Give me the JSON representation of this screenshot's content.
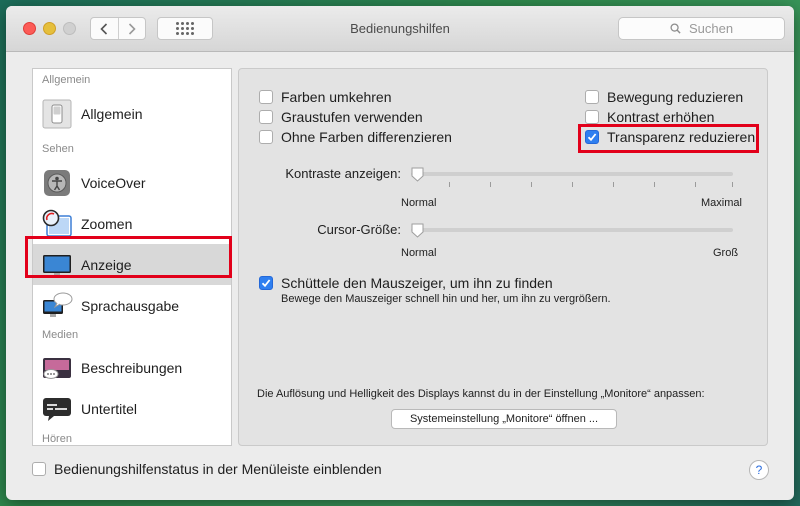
{
  "window": {
    "title": "Bedienungshilfen"
  },
  "toolbar": {
    "back_icon": "chevron-left-icon",
    "forward_icon": "chevron-right-icon",
    "grid_icon": "grid-icon"
  },
  "search": {
    "placeholder": "Suchen"
  },
  "sidebar": {
    "sections": [
      {
        "header": "Allgemein",
        "items": [
          {
            "label": "Allgemein",
            "icon": "general-switch-icon"
          }
        ]
      },
      {
        "header": "Sehen",
        "items": [
          {
            "label": "VoiceOver",
            "icon": "voiceover-icon"
          },
          {
            "label": "Zoomen",
            "icon": "zoom-icon"
          },
          {
            "label": "Anzeige",
            "icon": "display-icon",
            "selected": true
          },
          {
            "label": "Sprachausgabe",
            "icon": "speech-icon"
          }
        ]
      },
      {
        "header": "Medien",
        "items": [
          {
            "label": "Beschreibungen",
            "icon": "descriptions-icon"
          },
          {
            "label": "Untertitel",
            "icon": "subtitles-icon"
          }
        ]
      },
      {
        "header": "Hören",
        "items": []
      }
    ]
  },
  "display": {
    "options_left": [
      {
        "label": "Farben umkehren",
        "checked": false
      },
      {
        "label": "Graustufen verwenden",
        "checked": false
      },
      {
        "label": "Ohne Farben differenzieren",
        "checked": false
      }
    ],
    "options_right": [
      {
        "label": "Bewegung reduzieren",
        "checked": false
      },
      {
        "label": "Kontrast erhöhen",
        "checked": false
      },
      {
        "label": "Transparenz reduzieren",
        "checked": true
      }
    ],
    "contrast_slider": {
      "label": "Kontraste anzeigen:",
      "min_label": "Normal",
      "max_label": "Maximal",
      "value": 0
    },
    "cursor_slider": {
      "label": "Cursor-Größe:",
      "min_label": "Normal",
      "max_label": "Groß",
      "value": 0
    },
    "shake_option": {
      "label": "Schüttele den Mauszeiger, um ihn zu finden",
      "checked": true,
      "description": "Bewege den Mauszeiger schnell hin und her, um ihn zu vergrößern."
    },
    "monitor_info": "Die Auflösung und Helligkeit des Displays kannst du in der Einstellung „Monitore“ anpassen:",
    "monitor_button": "Systemeinstellung „Monitore“ öffnen ..."
  },
  "footer": {
    "status_checkbox_label": "Bedienungshilfenstatus in der Menüleiste einblenden",
    "status_checked": false,
    "help_label": "?"
  },
  "colors": {
    "checkbox_checked": "#2f7ff0",
    "highlight_annotation": "#e2001a",
    "selected_item": "#d8d8d8"
  }
}
